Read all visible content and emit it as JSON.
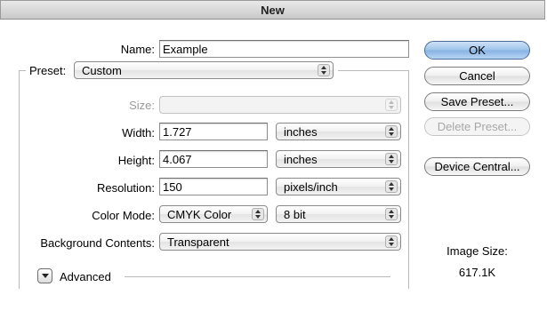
{
  "window": {
    "title": "New"
  },
  "form": {
    "name": {
      "label": "Name:",
      "value": "Example"
    },
    "preset": {
      "label": "Preset:",
      "value": "Custom"
    },
    "size": {
      "label": "Size:",
      "value": ""
    },
    "width": {
      "label": "Width:",
      "value": "1.727",
      "unit": "inches"
    },
    "height": {
      "label": "Height:",
      "value": "4.067",
      "unit": "inches"
    },
    "resolution": {
      "label": "Resolution:",
      "value": "150",
      "unit": "pixels/inch"
    },
    "color_mode": {
      "label": "Color Mode:",
      "mode": "CMYK Color",
      "depth": "8 bit"
    },
    "background": {
      "label": "Background Contents:",
      "value": "Transparent"
    },
    "advanced": {
      "label": "Advanced"
    }
  },
  "buttons": {
    "ok": "OK",
    "cancel": "Cancel",
    "save_preset": "Save Preset...",
    "delete_preset": "Delete Preset...",
    "device_central": "Device Central..."
  },
  "image_size": {
    "label": "Image Size:",
    "value": "617.1K"
  }
}
